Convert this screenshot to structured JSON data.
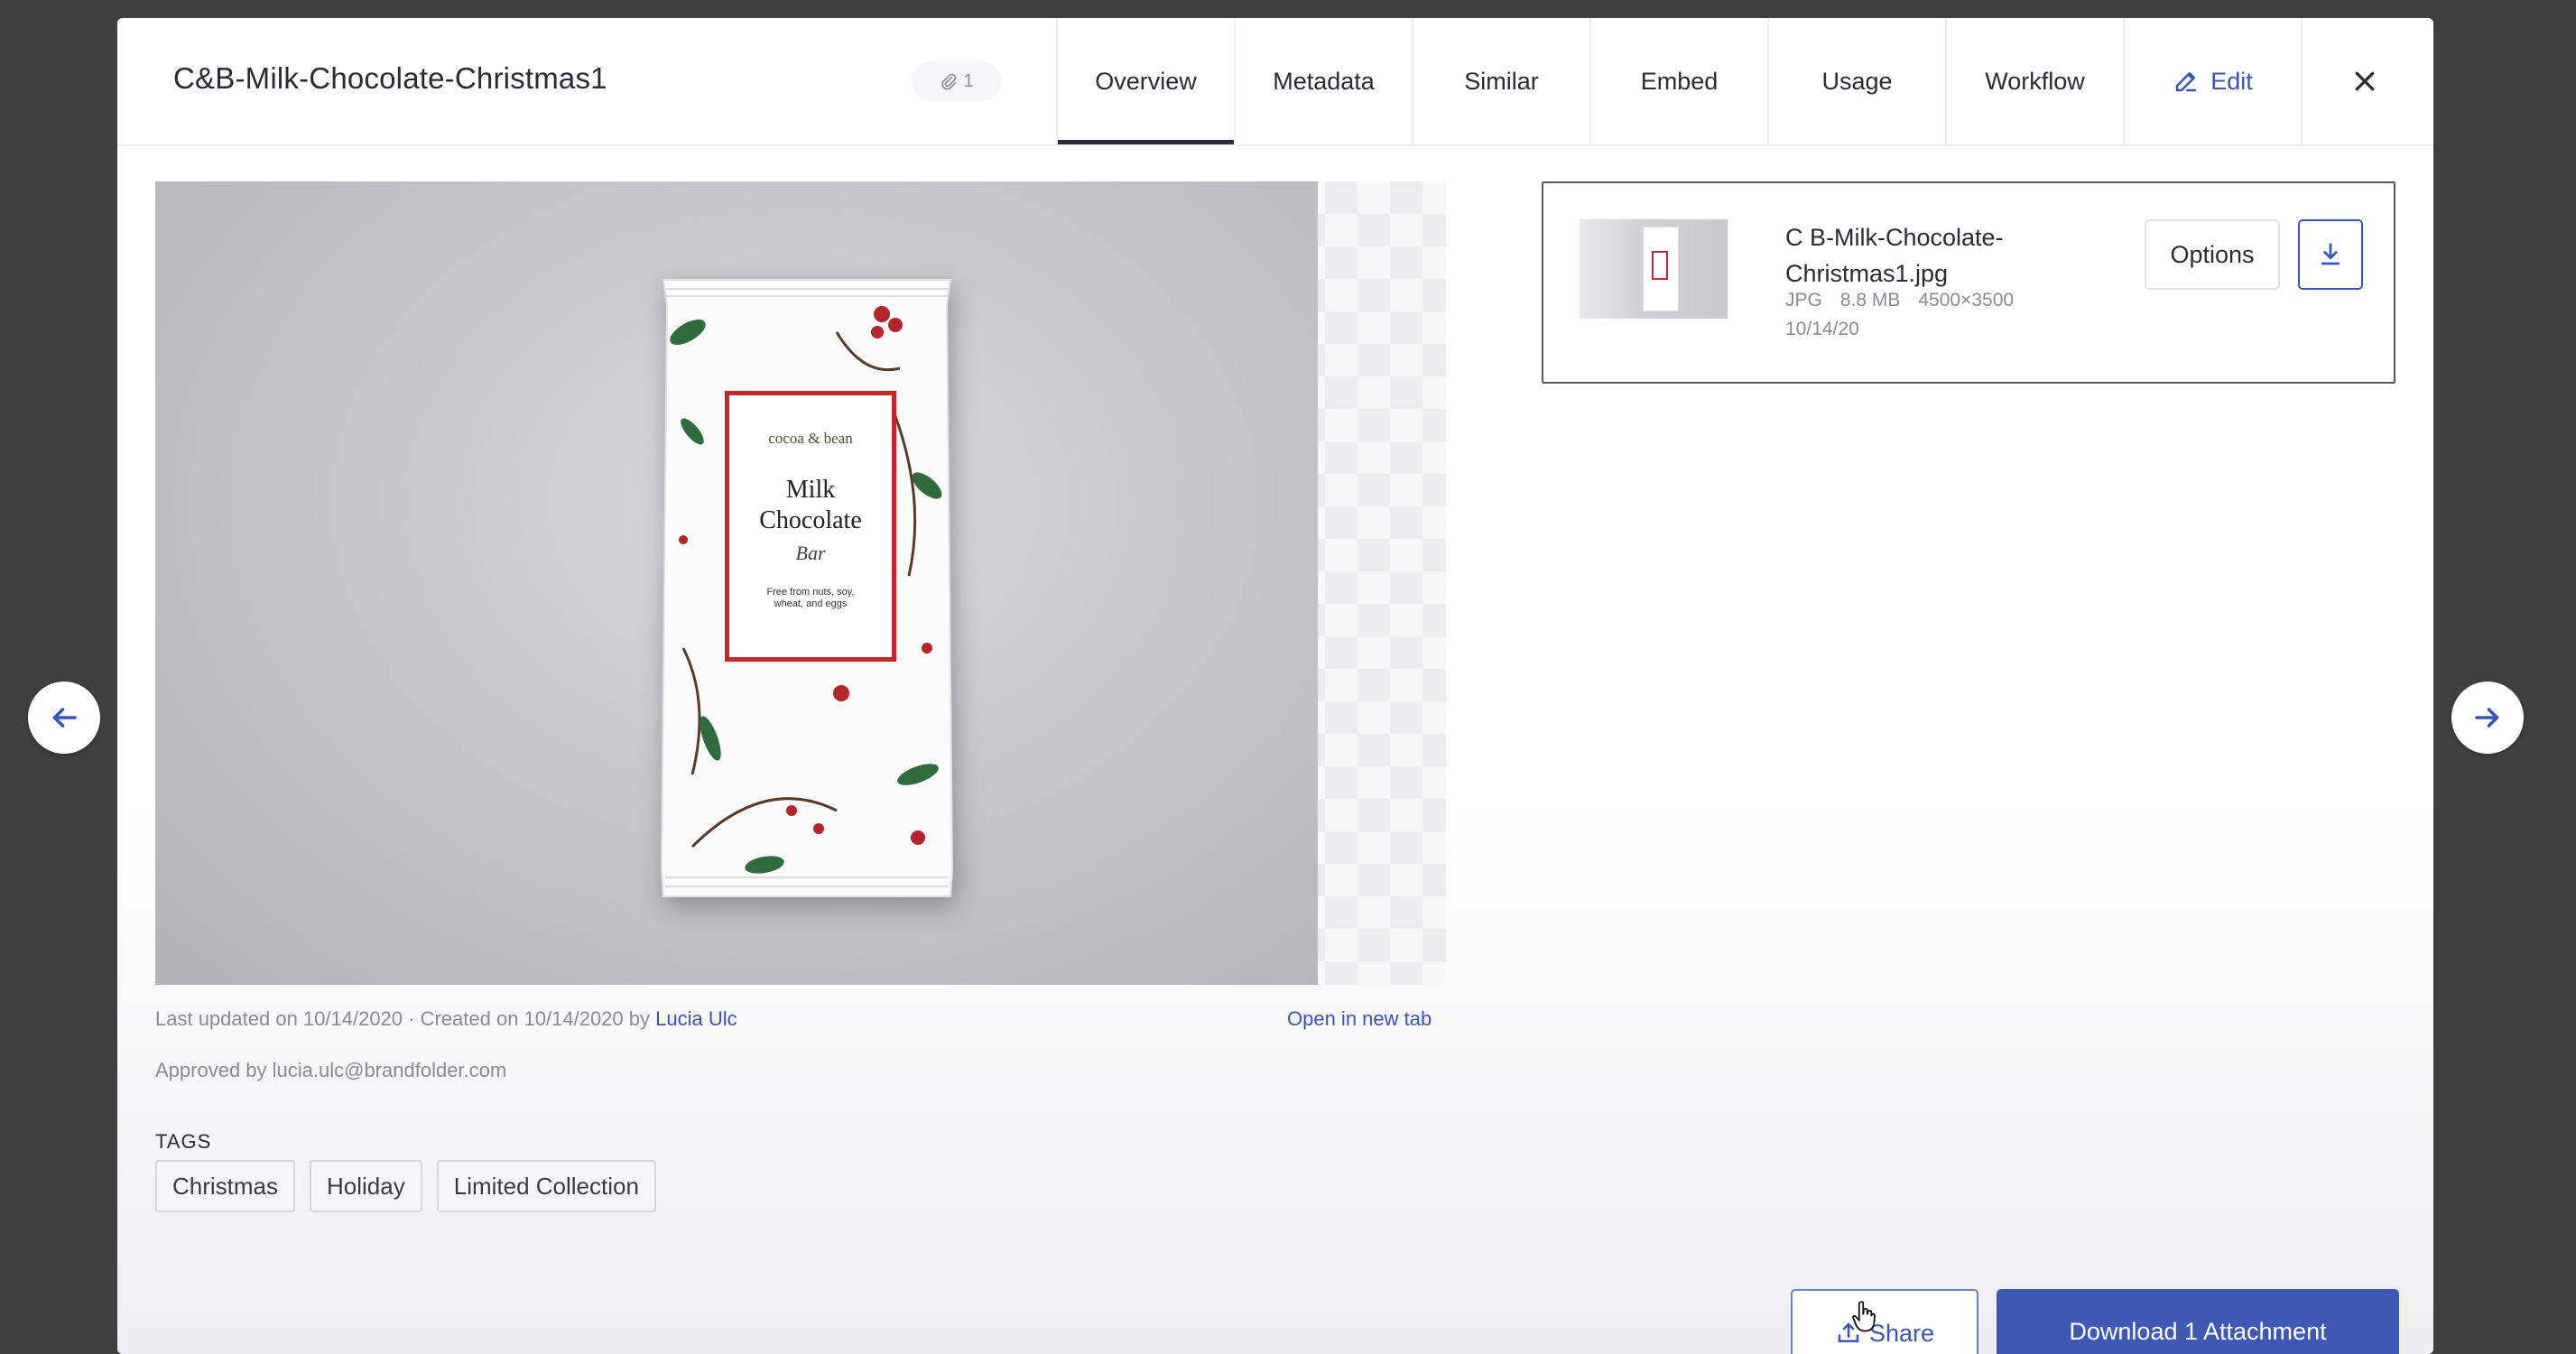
{
  "asset": {
    "title": "C&B-Milk-Chocolate-Christmas1",
    "attachment_count": "1"
  },
  "tabs": [
    {
      "label": "Overview",
      "active": true
    },
    {
      "label": "Metadata"
    },
    {
      "label": "Similar"
    },
    {
      "label": "Embed"
    },
    {
      "label": "Usage"
    },
    {
      "label": "Workflow"
    },
    {
      "label": "Edit",
      "icon": "pencil-icon"
    }
  ],
  "close_icon": "close-icon",
  "preview": {
    "brand": "cocoa & bean",
    "product_line1": "Milk",
    "product_line2": "Chocolate",
    "product_script": "Bar",
    "note": "Free from nuts, soy, wheat, and eggs"
  },
  "meta": {
    "updated_prefix": "Last updated on 10/14/2020 · Created on 10/14/2020 by ",
    "author": "Lucia Ulc",
    "open_new_tab": "Open in new tab",
    "approved": "Approved by lucia.ulc@brandfolder.com"
  },
  "tags": {
    "heading": "TAGS",
    "items": [
      "Christmas",
      "Holiday",
      "Limited Collection"
    ]
  },
  "attachment": {
    "file_name": "C B-Milk-Chocolate-Christmas1.jpg",
    "format": "JPG",
    "size": "8.8 MB",
    "dimensions": "4500×3500",
    "date": "10/14/20",
    "options_label": "Options",
    "download_icon": "download-icon"
  },
  "footer": {
    "share_label": "Share",
    "download_all_label": "Download 1 Attachment"
  },
  "colors": {
    "accent": "#3a55b8",
    "backdrop": "#404040",
    "label_red": "#c1272d"
  }
}
